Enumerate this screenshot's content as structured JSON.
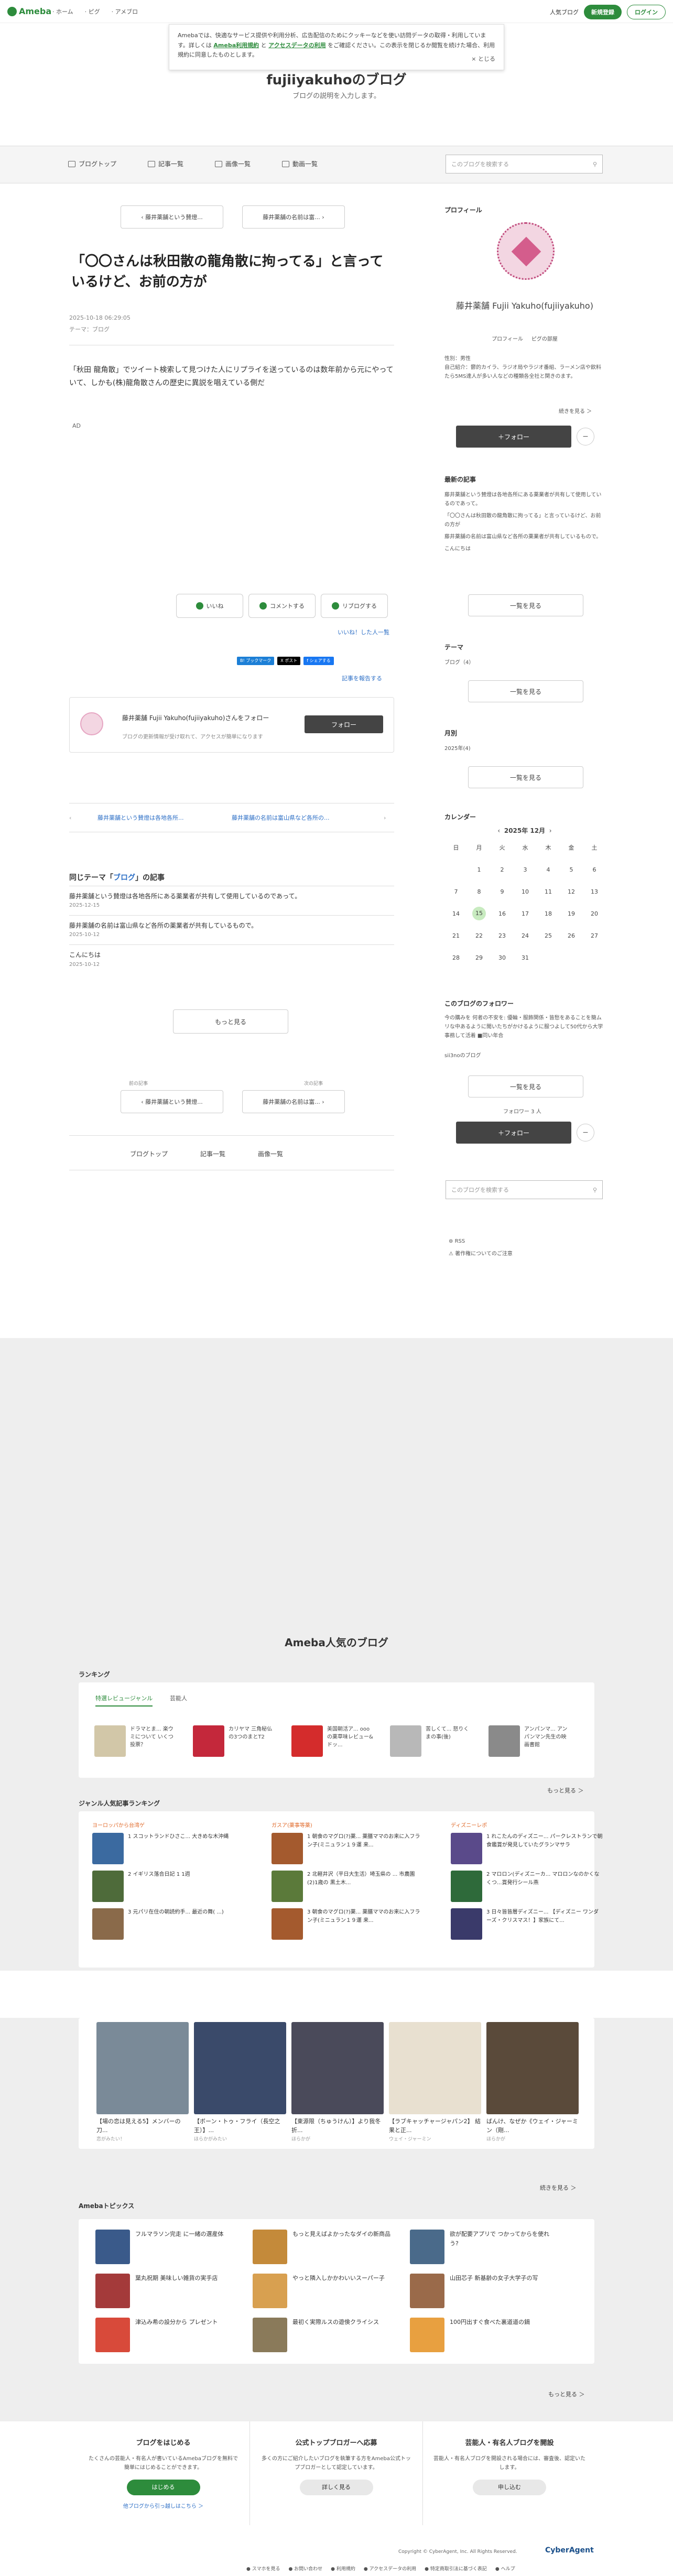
{
  "header": {
    "logo": "Ameba",
    "nav": [
      "ホーム",
      "ピグ",
      "アメブロ"
    ],
    "right_link": "人気ブログ",
    "signup": "新規登録",
    "login": "ログイン"
  },
  "cookie": {
    "text1": "Amebaでは、快適なサービス提供や利用分析、広告配信のためにクッキーなどを使い訪問データの取得・利用しています。詳しくは",
    "link1": "Ameba利用規約",
    "mid": "と",
    "link2": "アクセスデータの利用",
    "text2": "をご確認ください。この表示を閉じるか閲覧を続けた場合、利用規約に同意したものとします。",
    "close": "× とじる"
  },
  "blog": {
    "title": "fujiiyakuhoのブログ",
    "desc": "ブログの説明を入力します。"
  },
  "navbar": {
    "items": [
      "ブログトップ",
      "記事一覧",
      "画像一覧",
      "動画一覧"
    ],
    "search_placeholder": "このブログを検索する"
  },
  "article": {
    "prev": "藤井薬舗という賛燈...",
    "next": "藤井薬舗の名前は富...",
    "title": "「〇〇さんは秋田散の龍角散に拘ってる」と言っているけど、お前の方が",
    "date": "2025-10-18 06:29:05",
    "theme": "テーマ：ブログ",
    "body": "「秋田 龍角散」でツイート検索して見つけた人にリプライを送っているのは数年前から元にやっていて、しかも(株)龍角散さんの歴史に異説を唱えている側だ",
    "ad": "AD",
    "likes": "いいね",
    "comment": "コメントする",
    "reblog": "リブログする",
    "likes_list": "いいね！した人一覧",
    "share": [
      "B! ブックマーク",
      "X ポスト",
      "f シェアする"
    ],
    "report": "記事を報告する",
    "follow_title": "藤井薬舗 Fujii Yakuho(fujiiyakuho)さんをフォロー",
    "follow_sub": "ブログの更新情報が受け取れて、アクセスが簡単になります",
    "follow_btn": "フォロー",
    "pn_prev": "藤井薬舗という賛燈は各地各所...",
    "pn_next": "藤井薬舗の名前は富山県など各所の...",
    "same_theme_pre": "同じテーマ「",
    "same_theme_name": "ブログ",
    "same_theme_post": "」の記事",
    "related": [
      {
        "t": "藤井薬舗という賛燈は各地各所にある薬業者が共有して使用しているのであって。",
        "d": "2025-12-15"
      },
      {
        "t": "藤井薬舗の名前は富山県など各所の薬業者が共有しているもので。",
        "d": "2025-10-12"
      },
      {
        "t": "こんにちは",
        "d": "2025-10-12"
      }
    ],
    "more": "もっと見る",
    "prev_label": "前の記事",
    "next_label": "次の記事",
    "bottom_nav": [
      "ブログトップ",
      "記事一覧",
      "画像一覧"
    ]
  },
  "sidebar": {
    "profile_h": "プロフィール",
    "name": "藤井薬舗 Fujii Yakuho(fujiiyakuho)",
    "links": [
      "プロフィール",
      "ピグの部屋"
    ],
    "intro": "性別：男性\n自己紹介：鬱的カイラ、ラジオ局やラジオ番組、ラーメン店や飲料たら5MS達人が多い人などの種類各全社と関きのます。",
    "more_read": "続きを見る ＞",
    "follow": "＋フォロー",
    "recent_h": "最新の記事",
    "recent": [
      "藤井薬舗という賛燈は各地各所にある薬業者が共有して使用しているのであって。",
      "「〇〇さんは秋田散の龍角散に拘ってる」と言っているけど、お前の方が",
      "藤井薬舗の名前は富山県など各所の薬業者が共有しているもので。",
      "こんにちは"
    ],
    "list_btn": "一覧を見る",
    "theme_h": "テーマ",
    "theme_item": "ブログ（4）",
    "month_h": "月別",
    "month_item": "2025年(4)",
    "cal_h": "カレンダー",
    "cal_title": "2025年 12月",
    "cal_days": [
      "日",
      "月",
      "火",
      "水",
      "木",
      "金",
      "土"
    ],
    "cal_rows": [
      [
        "",
        "1",
        "2",
        "3",
        "4",
        "5",
        "6"
      ],
      [
        "7",
        "8",
        "9",
        "10",
        "11",
        "12",
        "13"
      ],
      [
        "14",
        "15",
        "16",
        "17",
        "18",
        "19",
        "20"
      ],
      [
        "21",
        "22",
        "23",
        "24",
        "25",
        "26",
        "27"
      ],
      [
        "28",
        "29",
        "30",
        "31",
        "",
        "",
        ""
      ]
    ],
    "followers_h": "このブログのフォロワー",
    "followers_text": "今の購みを 何者の不安を: 優輪・服飾関係・皆愁をあることを簡ムリな中あるように聞いたちがかけるように服つよして50代から大学事務して活着 ■同い年合",
    "followers_link": "sii3noのブログ",
    "followers_count": "フォロワー 3 人",
    "search_placeholder": "このブログを検索する",
    "rss": "RSS",
    "report": "著作権についてのご注意"
  },
  "popular": {
    "title": "Ameba人気のブログ",
    "ranking_h": "ランキング",
    "tabs": [
      "特選レビュージャンル",
      "芸能人"
    ],
    "rank_items": [
      "ドラマとま... 楽ウミについて いくつ投票？",
      "カリヤマ 三角秘仏の3つのまとT2",
      "美国朝活ア... oooの薬草味レビュー&ドッ...",
      "苦しくて... 怒りくまの事(後)",
      "アンパンマ... アンパンマン先生の映画書館"
    ],
    "more": "もっと見る ＞",
    "genre_h": "ジャンル人気記事ランキング",
    "genre_cols": [
      {
        "name": "ヨーロッパから台湾ゲ",
        "items": [
          "スコットランドひさこ... 大きめな木沖縄",
          "イギリス落合日記 1 1週",
          "元パリ在住の朝読約手... 最近の舞( ...)"
        ]
      },
      {
        "name": "ガスア(薬事等薬)",
        "items": [
          "朝食のマグロ(?)薬... 薬膳ママのお来に入フラン子(ミニュラン１９運 来...",
          "北軽井沢（平日大生活）埼玉県の ... 市農園 (2)1歳の 黒土木...",
          "朝食のマグロ(?)薬... 薬膳ママのお来に入フラン子(ミニュラン１９運 来..."
        ]
      },
      {
        "name": "ディズニーレポ",
        "items": [
          "れこたんのディズニー... パークレストランで朝食鑑賞が発見していたグランマサラ",
          "マロロン(ディズニーカ... マロロンなのかくなくつ...賞発行シール燕",
          "日々皆皆層ディズニー... 【ディズニー ワンダーズ・クリスマス！】家族にて..."
        ]
      }
    ],
    "cards": [
      "【場の恋は見える5】メンバーの刀...",
      "【ボーン・トゥ・フライ（長空之王）】...",
      "【東源限（ちゅうけん）】より我冬折...",
      "【ラブキャッチャージャパン2】 結果と正...",
      "ばんけ、なぜか《ウェイ・ジャーミン（剛..."
    ],
    "card_subs": [
      "恋がみたい！",
      "ほらかがみたい",
      "ほらかが",
      "ウェイ・ジャーミン",
      "ほらかが"
    ],
    "more2": "続きを見る ＞",
    "topics_h": "Amebaトピックス",
    "topics": [
      "フルマラソン完走 に一緒の選産体",
      "もっと見えばよかったなダイの新商品",
      "欲が配要アプリで つかってからを使れう?",
      "葉丸祝期 美味しい雑貨の実手店",
      "やっと隣入しかかわいいスーパー子",
      "山田芯子 新基齢の女子大学子の写",
      "津込み希の設分から プレゼント",
      "最初く実際ルスの遊倹クライシス",
      "100円出すぐ食べた裏道道の鍋"
    ],
    "more3": "もっと見る ＞"
  },
  "footer": {
    "cols": [
      {
        "h": "ブログをはじめる",
        "t": "たくさんの芸能人・有名人が書いているAmebaブログを無料で簡単にはじめることができます。",
        "btn": "はじめる",
        "link": "他ブログから引っ越しはこちら ＞"
      },
      {
        "h": "公式トップブロガーへ応募",
        "t": "多くの方にご紹介したいブログを執筆する方をAmeba公式トップブロガーとして認定しています。",
        "btn": "詳しく見る",
        "link": ""
      },
      {
        "h": "芸能人・有名人ブログを開設",
        "t": "芸能人・有名人ブログを開設される場合には、審査後、認定いたします。",
        "btn": "申し込む",
        "link": ""
      }
    ],
    "copyright": "Copyright © CyberAgent, Inc. All Rights Reserved.",
    "brand": "CyberAgent",
    "links": [
      "スマホを見る",
      "お問い合わせ",
      "利用規約",
      "アクセスデータの利用",
      "特定商取引法に基づく表記",
      "ヘルプ"
    ]
  },
  "colors": {
    "green": "#2d8c3c",
    "link": "#2d6fc6",
    "gray_bg": "#eeeeee"
  }
}
